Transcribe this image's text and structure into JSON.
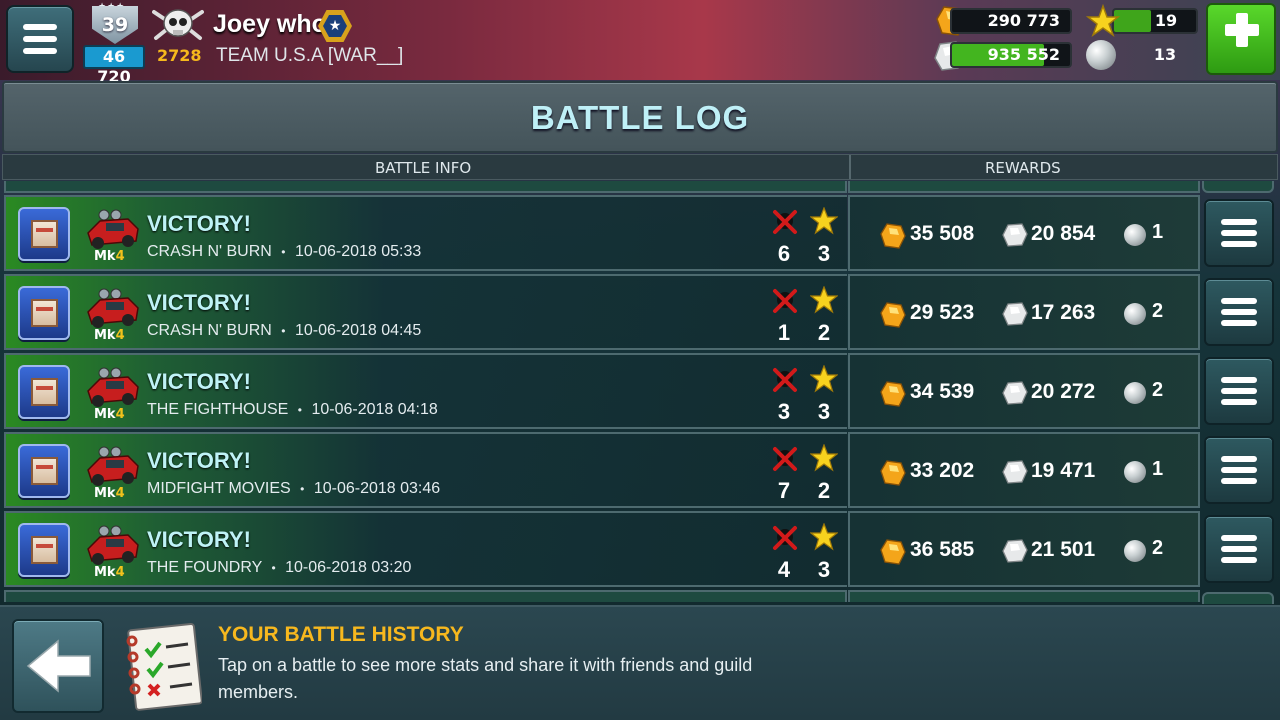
{
  "player": {
    "level": "39",
    "xp": "46 720",
    "trophies": "2728",
    "name": "Joey who",
    "team": "TEAM U.S.A [WAR__]"
  },
  "resources": {
    "gold": "290 773",
    "silver": "935 552",
    "silver_fill_fraction": 0.78,
    "stars": "19",
    "stars_fill_fraction": 0.45,
    "pearls": "13"
  },
  "page": {
    "title": "BATTLE LOG",
    "col_battle_info": "BATTLE INFO",
    "col_rewards": "REWARDS"
  },
  "colors": {
    "gold_text": "#f7b81e",
    "title_text": "#bff0f7",
    "victory_green": "#2a8a22",
    "plus_green": "#43b51f"
  },
  "battles": [
    {
      "result": "VICTORY!",
      "map": "CRASH N' BURN",
      "datetime": "10-06-2018 05:33",
      "kills": "6",
      "stars": "3",
      "gold": "35 508",
      "silver": "20 854",
      "pearls": "1",
      "mk": "Mk",
      "mk_level": "4"
    },
    {
      "result": "VICTORY!",
      "map": "CRASH N' BURN",
      "datetime": "10-06-2018 04:45",
      "kills": "1",
      "stars": "2",
      "gold": "29 523",
      "silver": "17 263",
      "pearls": "2",
      "mk": "Mk",
      "mk_level": "4"
    },
    {
      "result": "VICTORY!",
      "map": "THE FIGHTHOUSE",
      "datetime": "10-06-2018 04:18",
      "kills": "3",
      "stars": "3",
      "gold": "34 539",
      "silver": "20 272",
      "pearls": "2",
      "mk": "Mk",
      "mk_level": "4"
    },
    {
      "result": "VICTORY!",
      "map": "MIDFIGHT MOVIES",
      "datetime": "10-06-2018 03:46",
      "kills": "7",
      "stars": "2",
      "gold": "33 202",
      "silver": "19 471",
      "pearls": "1",
      "mk": "Mk",
      "mk_level": "4"
    },
    {
      "result": "VICTORY!",
      "map": "THE FOUNDRY",
      "datetime": "10-06-2018 03:20",
      "kills": "4",
      "stars": "3",
      "gold": "36 585",
      "silver": "21 501",
      "pearls": "2",
      "mk": "Mk",
      "mk_level": "4"
    }
  ],
  "separator": "•",
  "footer": {
    "title": "YOUR BATTLE HISTORY",
    "description": "Tap on a battle to see more stats and share it with friends and guild members."
  },
  "icons": {
    "menu": "hamburger-menu-icon",
    "skull": "skull-avatar-icon",
    "rank": "rank-star-badge-icon",
    "gold": "gold-gem-icon",
    "silver": "silver-gem-icon",
    "star": "star-icon",
    "pearl": "pearl-icon",
    "plus": "plus-icon",
    "kill": "crossed-skull-icon",
    "guild": "guild-fort-badge-icon",
    "car": "car-icon",
    "back": "back-arrow-icon",
    "notebook": "checklist-notebook-icon"
  }
}
